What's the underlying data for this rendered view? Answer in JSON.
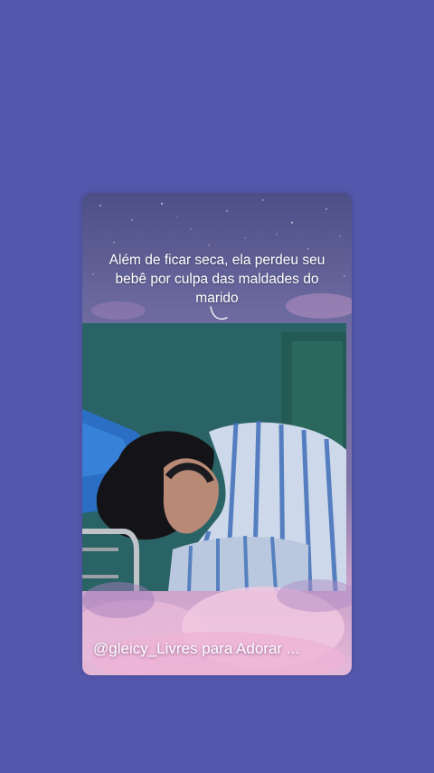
{
  "story": {
    "caption": "Além de ficar seca, ela perdeu seu bebê por culpa das maldades do marido",
    "username": "@gleicy_Livres para Adorar ..."
  },
  "colors": {
    "page_background": "#5457ab",
    "caption_text": "#ffffff"
  },
  "icons": {
    "swoosh": "caption-swoosh-icon"
  }
}
